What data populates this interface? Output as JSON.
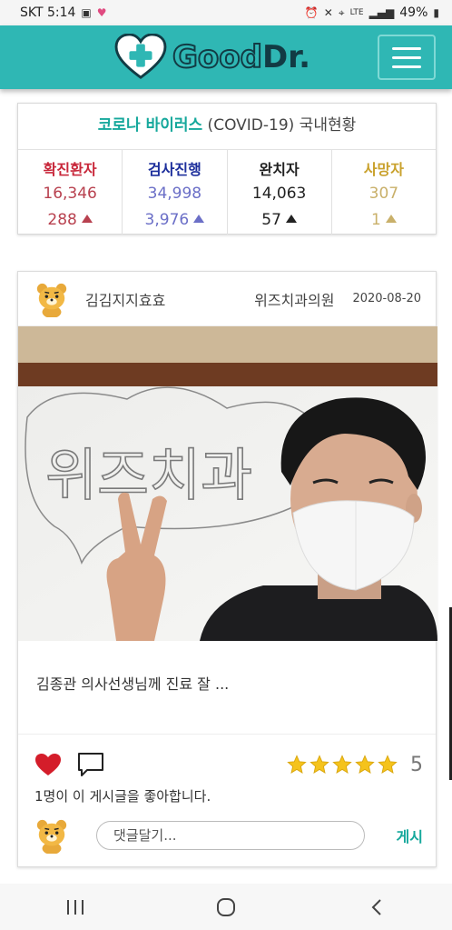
{
  "status_bar": {
    "carrier_time": "SKT 5:14",
    "battery": "49%",
    "network": "LTE"
  },
  "app": {
    "logo_good": "Good",
    "logo_dr": "Dr.",
    "brand_color": "#2fb7b4"
  },
  "covid": {
    "title_main": "코로나 바이러스",
    "title_sub": " (COVID-19) 국내현황",
    "columns": [
      {
        "label": "확진환자",
        "total": "16,346",
        "delta": "288",
        "color": "#c8273a"
      },
      {
        "label": "검사진행",
        "total": "34,998",
        "delta": "3,976",
        "color": "#1d2f9c"
      },
      {
        "label": "완치자",
        "total": "14,063",
        "delta": "57",
        "color": "#222222"
      },
      {
        "label": "사망자",
        "total": "307",
        "delta": "1",
        "color": "#c9a12c"
      }
    ]
  },
  "post": {
    "author": "김김지지효효",
    "clinic": "위즈치과의원",
    "date": "2020-08-20",
    "photo_board_text": "위즈치과",
    "text": "김종관 의사선생님께 진료 잘 ...",
    "rating": "5",
    "rating_stars": 5,
    "likes": "1명이 이 게시글을 좋아합니다.",
    "comment_placeholder": "댓글달기...",
    "post_button": "게시"
  },
  "icons": {
    "heart": "heart-icon",
    "comment": "comment-icon",
    "star": "star-icon",
    "menu": "menu-icon"
  }
}
